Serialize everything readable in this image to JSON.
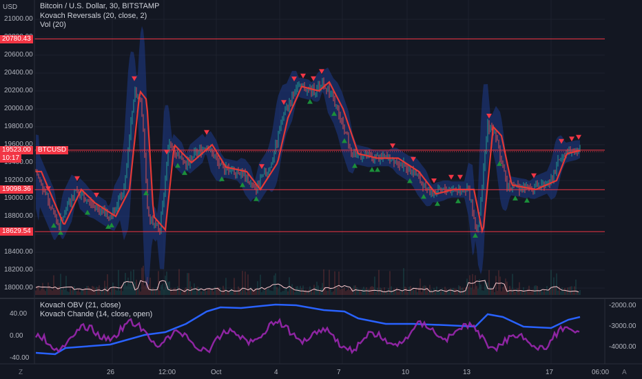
{
  "header": {
    "title": "Bitcoin / U.S. Dollar, 30, BITSTAMP",
    "indicator1": "Kovach Reversals (20, close, 2)",
    "indicator2": "Vol (20)",
    "currency": "USD"
  },
  "lower": {
    "indicator1": "Kovach OBV (21, close)",
    "indicator2": "Kovach Chande (14, close, open)"
  },
  "price_axis": {
    "labels": [
      "21000.00",
      "20800.00",
      "20600.00",
      "20400.00",
      "20200.00",
      "20000.00",
      "19800.00",
      "19600.00",
      "19400.00",
      "19200.00",
      "19000.00",
      "18800.00",
      "18600.00",
      "18400.00",
      "18200.00",
      "18000.00"
    ]
  },
  "lower_left_axis": [
    "40.00",
    "0.00",
    "-40.00"
  ],
  "lower_right_axis": [
    "-2000.00",
    "-3000.00",
    "-4000.00"
  ],
  "time_axis": [
    "26",
    "12:00",
    "Oct",
    "4",
    "7",
    "10",
    "13",
    "17",
    "06:00"
  ],
  "levels": [
    {
      "value": "20780.43",
      "color": "#f23645"
    },
    {
      "value": "19539.67",
      "color": "#f23645"
    },
    {
      "value": "19098.36",
      "color": "#f23645"
    },
    {
      "value": "18629.54",
      "color": "#f23645"
    }
  ],
  "current": {
    "price": "19523.00",
    "symbol": "BTCUSD",
    "countdown": "10:17",
    "color": "#f23645"
  },
  "corner": {
    "left": "Z",
    "right": "A"
  },
  "colors": {
    "up": "#26a69a",
    "down": "#ef5350",
    "band": "#1e3a8a",
    "signal": "#e53935",
    "obv": "#2962ff",
    "chande": "#9c27b0",
    "volume_ma": "#ffcdd2"
  }
}
